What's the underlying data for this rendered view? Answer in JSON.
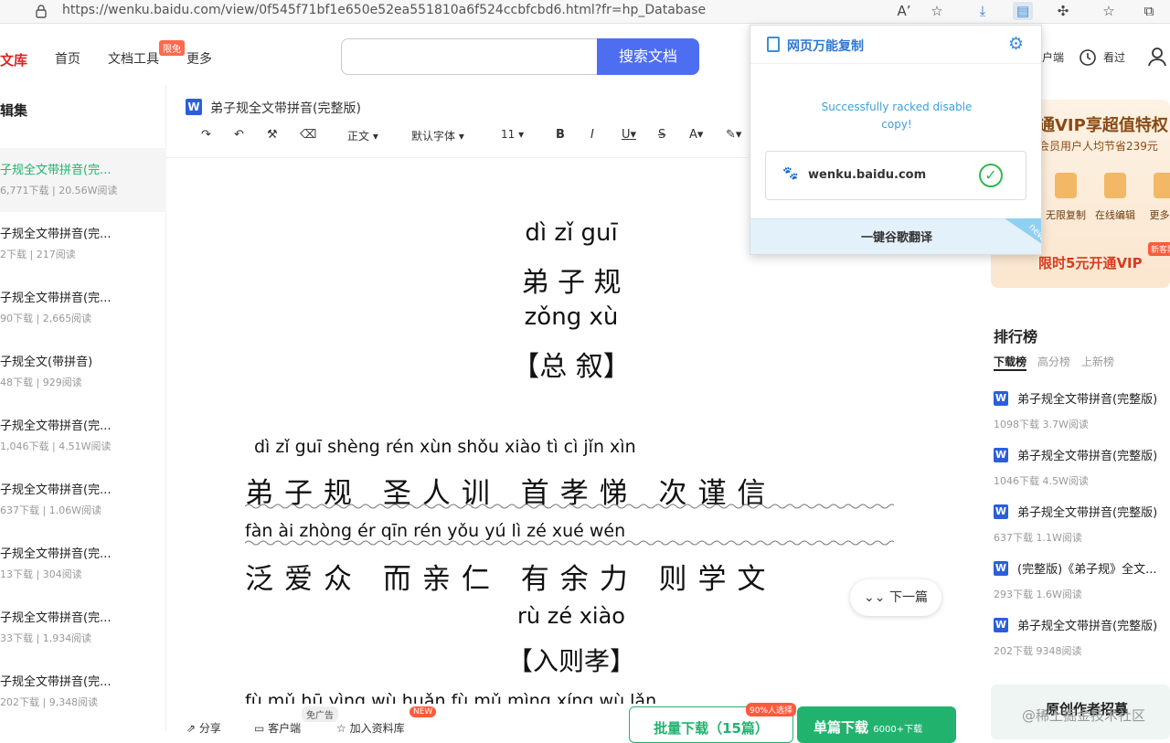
{
  "browser": {
    "url": "https://wenku.baidu.com/view/0f545f71bf1e650e52ea551810a6f524ccbfcbd6.html?fr=hp_Database"
  },
  "header": {
    "logo": "文库",
    "nav": [
      "首页",
      "文档工具",
      "更多"
    ],
    "limited_badge": "限免",
    "search_button": "搜索文档",
    "search_placeholder": "",
    "client_partial": "户端",
    "recent": "看过"
  },
  "sidebar": {
    "title": "辑集",
    "items": [
      {
        "title": "子规全文带拼音(完...",
        "meta": "6,771下载 | 20.56W阅读"
      },
      {
        "title": "子规全文带拼音(完...",
        "meta": "2下载 | 217阅读"
      },
      {
        "title": "子规全文带拼音(完...",
        "meta": "90下载 | 2,665阅读"
      },
      {
        "title": "子规全文(带拼音)",
        "meta": "48下载 | 929阅读"
      },
      {
        "title": "子规全文带拼音(完...",
        "meta": "1,046下载 | 4.51W阅读"
      },
      {
        "title": "子规全文带拼音(完...",
        "meta": "637下载 | 1.06W阅读"
      },
      {
        "title": "子规全文带拼音(完...",
        "meta": "13下载 | 304阅读"
      },
      {
        "title": "子规全文带拼音(完...",
        "meta": "33下载 | 1,934阅读"
      },
      {
        "title": "子规全文带拼音(完...",
        "meta": "202下载 | 9,348阅读"
      }
    ]
  },
  "doc": {
    "word_icon": "W",
    "title": "弟子规全文带拼音(完整版)",
    "toolbar": {
      "style": "正文 ▾",
      "font": "默认字体 ▾",
      "size": "11 ▾"
    },
    "heading_pinyin": "dì    zǐ    guī",
    "heading_hanzi": "弟    子    规",
    "sub_pinyin": "zǒng    xù",
    "sub_hanzi": "【总    叙】",
    "line1_pinyin": "dì  zǐ  guī    shèng rén xùn     shǒu xiào tì      cì  jǐn  xìn",
    "line1_hanzi": "弟子规  圣人训  首孝悌   次谨信",
    "line2_pinyin": "fàn  ài zhòng   ér  qīn  rén   yǒu  yú  lì     zé xué wén",
    "line2_hanzi": "泛爱众  而亲仁  有余力   则学文",
    "sec2_pinyin": "rù  zé  xiào",
    "sec2_hanzi": "【入则孝】",
    "line3_pinyin": "fù   mǔ  hū     yìng  wù  huǎn    fù  mǔ  mìng    xíng  wù  lǎn",
    "next": "下一篇"
  },
  "right": {
    "vip_title": "通VIP享超值特权",
    "vip_sub": "会员用户人均节省239元",
    "vip_features": [
      "无限复制",
      "在线编辑",
      "更多特"
    ],
    "vip_badge": "新客限时",
    "vip_cta": "限时5元开通VIP",
    "rank_title": "排行榜",
    "rank_tabs": [
      "下载榜",
      "高分榜",
      "上新榜"
    ],
    "rank_items": [
      {
        "title": "弟子规全文带拼音(完整版)",
        "meta": "1098下载    3.7W阅读"
      },
      {
        "title": "弟子规全文带拼音(完整版)",
        "meta": "1046下载    4.5W阅读"
      },
      {
        "title": "弟子规全文带拼音(完整版)",
        "meta": "637下载    1.1W阅读"
      },
      {
        "title": "(完整版)《弟子规》全文...",
        "meta": "293下载    1.6W阅读"
      },
      {
        "title": "弟子规全文带拼音(完整版)",
        "meta": "202下载    9348阅读"
      }
    ],
    "recruit": "原创作者招募"
  },
  "bottom": {
    "share": "分享",
    "client": "客户端",
    "ad_free": "免广告",
    "add_lib": "加入资料库",
    "new_badge": "NEW",
    "batch": "批量下载（15篇）",
    "batch_badge": "90%人选择",
    "single": "单篇下载",
    "single_sub": "6000+下载"
  },
  "popup": {
    "title": "网页万能复制",
    "message": "Successfully racked disable copy!",
    "site": "wenku.baidu.com",
    "translate": "一键谷歌翻译",
    "corner": "new"
  },
  "watermark": "@稀土掘金技术社区",
  "colors": {
    "accent_blue": "#4e6ef2",
    "green": "#21b36e",
    "red": "#e02020"
  }
}
